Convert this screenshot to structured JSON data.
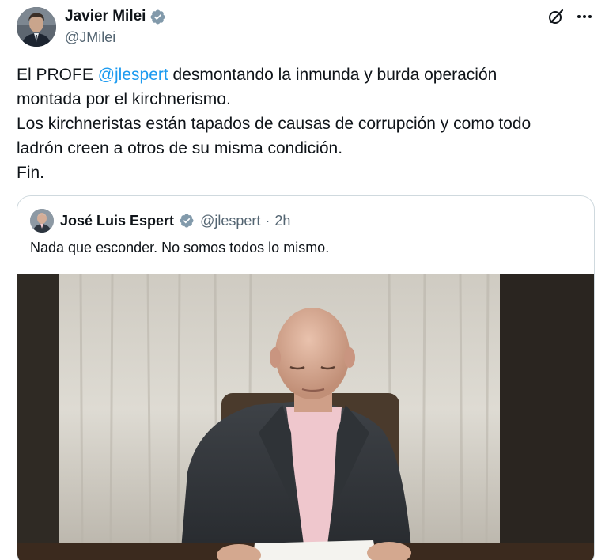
{
  "author": {
    "name": "Javier Milei",
    "handle": "@JMilei",
    "verified": true
  },
  "tweet": {
    "lines": [
      {
        "before": "El PROFE ",
        "mention": "@jlespert",
        "after": " desmontando la inmunda y burda operación"
      },
      {
        "text": "montada por el kirchnerismo."
      },
      {
        "text": "Los kirchneristas están tapados de causas de corrupción y como todo"
      },
      {
        "text": "ladrón creen a otros de su misma condición."
      },
      {
        "text": "Fin."
      }
    ]
  },
  "quote": {
    "name": "José Luis Espert",
    "handle": "@jlespert",
    "separator": "·",
    "time": "2h",
    "verified": true,
    "text": "Nada que esconder. No somos todos lo mismo.",
    "media_icon": "photo-man-reading-at-desk"
  },
  "icons": {
    "grok": "grok-icon",
    "more": "more-icon",
    "verified": "verified-badge-icon"
  },
  "colors": {
    "link": "#1d9bf0",
    "text": "#0f1419",
    "secondary": "#536471",
    "border": "#cfd9de"
  }
}
